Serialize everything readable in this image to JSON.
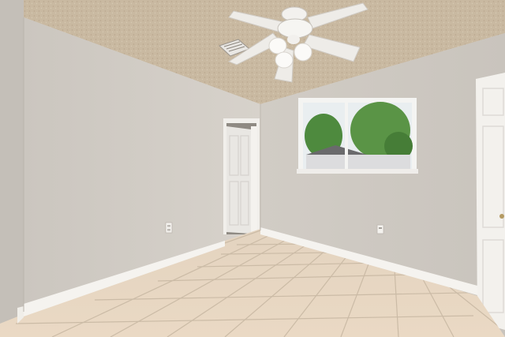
{
  "scene": {
    "description_free": true,
    "palette": {
      "ceiling": "#c8b8a0",
      "left_wall": "#d2cdc6",
      "back_wall": "#cfcac3",
      "right_wall": "#d6d1ca",
      "floor_tile": "#e6d6c2",
      "grout": "#c9b9a4",
      "baseboard": "#f4f2ee",
      "door": "#f2f0ec",
      "window_sky": "#e8eef0",
      "tree_green": "#4f8a3f"
    },
    "icons": [
      "ceiling-fan-icon",
      "air-vent-icon",
      "power-outlet-icon"
    ]
  }
}
